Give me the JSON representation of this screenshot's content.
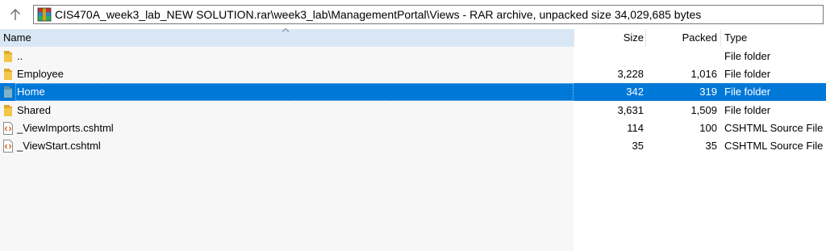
{
  "address": {
    "path": "CIS470A_week3_lab_NEW SOLUTION.rar\\week3_lab\\ManagementPortal\\Views - RAR archive, unpacked size 34,029,685 bytes",
    "up_icon": "up-arrow-icon",
    "archive_icon": "winrar-archive-icon"
  },
  "columns": {
    "name": "Name",
    "size": "Size",
    "packed": "Packed",
    "type": "Type",
    "sort_column": "Name",
    "sort_direction": "ascending"
  },
  "rows": [
    {
      "name": "..",
      "size": "",
      "packed": "",
      "type": "File folder",
      "icon": "folder-icon",
      "selected": false
    },
    {
      "name": "Employee",
      "size": "3,228",
      "packed": "1,016",
      "type": "File folder",
      "icon": "folder-icon",
      "selected": false
    },
    {
      "name": "Home",
      "size": "342",
      "packed": "319",
      "type": "File folder",
      "icon": "folder-icon",
      "selected": true
    },
    {
      "name": "Shared",
      "size": "3,631",
      "packed": "1,509",
      "type": "File folder",
      "icon": "folder-icon",
      "selected": false
    },
    {
      "name": "_ViewImports.cshtml",
      "size": "114",
      "packed": "100",
      "type": "CSHTML Source File",
      "icon": "cshtml-file-icon",
      "selected": false
    },
    {
      "name": "_ViewStart.cshtml",
      "size": "35",
      "packed": "35",
      "type": "CSHTML Source File",
      "icon": "cshtml-file-icon",
      "selected": false
    }
  ],
  "colors": {
    "selection": "#0078d7",
    "header_highlight": "#d9e7f5",
    "folder": "#f3c74a"
  }
}
